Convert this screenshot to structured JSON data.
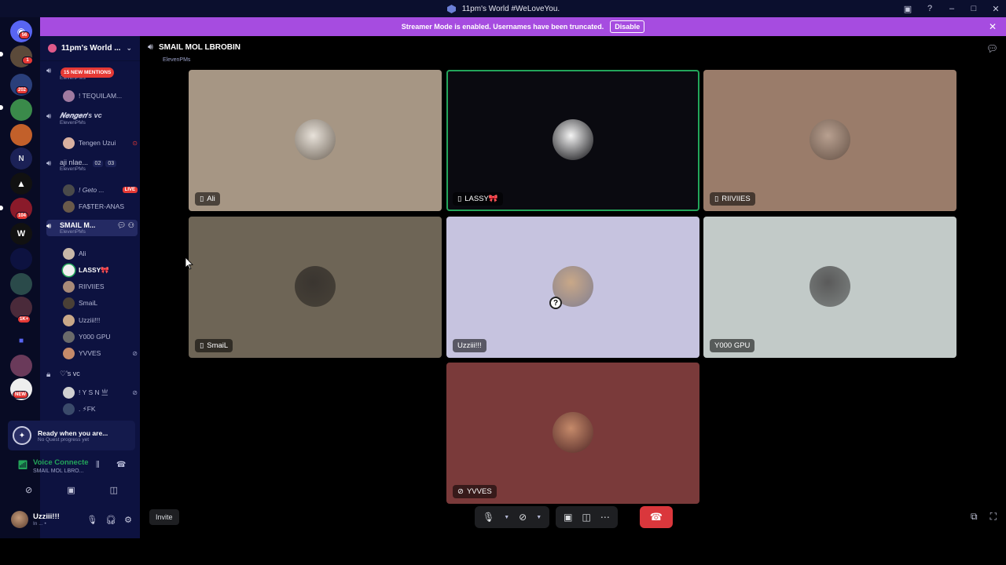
{
  "window": {
    "title": "11pm's World #WeLoveYou."
  },
  "banner": {
    "text": "Streamer Mode is enabled. Usernames have been truncated.",
    "disable_label": "Disable"
  },
  "rail": {
    "badges": [
      "56",
      "1",
      "202",
      "N",
      "104",
      "1K+",
      "NEW"
    ]
  },
  "sidebar": {
    "guild_name": "11pm's World ...",
    "mentions_label": "15 NEW MENTIONS",
    "channels": [
      {
        "name": "",
        "sub": "ElevenPMs"
      },
      {
        "name": "𝑵𝒆𝒏𝒈𝒆𝒏's vc",
        "sub": "ElevenPMs"
      },
      {
        "name": "aji nlae...",
        "sub": "ElevenPMs",
        "c1": "02",
        "c2": "03"
      },
      {
        "name": "SMAIL M...",
        "sub": "ElevenPMs"
      },
      {
        "name": "♡'s vc",
        "sub": ""
      }
    ],
    "members_top": [
      {
        "name": "! TEQUILAM..."
      },
      {
        "name": "Tengen Uzui"
      },
      {
        "name": "! Geto ...",
        "live": "LIVE"
      },
      {
        "name": "FA$TER-ANAS"
      }
    ],
    "members_active": [
      {
        "name": "Ali"
      },
      {
        "name": "LASSY🎀"
      },
      {
        "name": "RIIVIIES"
      },
      {
        "name": "SmaiL"
      },
      {
        "name": "Uzziii!!!"
      },
      {
        "name": "Y000 GPU"
      },
      {
        "name": "YVVES"
      }
    ],
    "members_bottom": [
      {
        "name": "! Y S N 亗"
      },
      {
        "name": ". ⚡FK"
      }
    ]
  },
  "quest": {
    "title": "Ready when you are...",
    "subtitle": "No Quest progress yet"
  },
  "voice": {
    "status": "Voice Connecte",
    "channel": "SMAIL MOL LBRO..."
  },
  "user": {
    "name": "Uzziii!!!",
    "status": "In ... •"
  },
  "call": {
    "channel_name": "SMAIL MOL LBROBIN",
    "server_name": "ElevenPMs",
    "invite_label": "Invite",
    "tiles": [
      {
        "name": "Ali",
        "icon": "phone",
        "bg": "#a69684",
        "av": "#e8e2da"
      },
      {
        "name": "LASSY🎀",
        "icon": "phone",
        "bg": "#0a0a10",
        "av": "#f4f4f4",
        "speaking": true
      },
      {
        "name": "RIIVIIES",
        "icon": "phone",
        "bg": "#9a7c6a",
        "av": "#b8a090"
      },
      {
        "name": "SmaiL",
        "icon": "phone",
        "bg": "#6e6556",
        "av": "#3a3530"
      },
      {
        "name": "Uzziii!!!",
        "icon": "",
        "bg": "#c6c3df",
        "av": "#c9a888"
      },
      {
        "name": "Y000 GPU",
        "icon": "",
        "bg": "#c2cac8",
        "av": "#5a5a5a"
      },
      {
        "name": "YVVES",
        "icon": "muted",
        "bg": "#7a3a3a",
        "av": "#c58a6a"
      }
    ]
  }
}
